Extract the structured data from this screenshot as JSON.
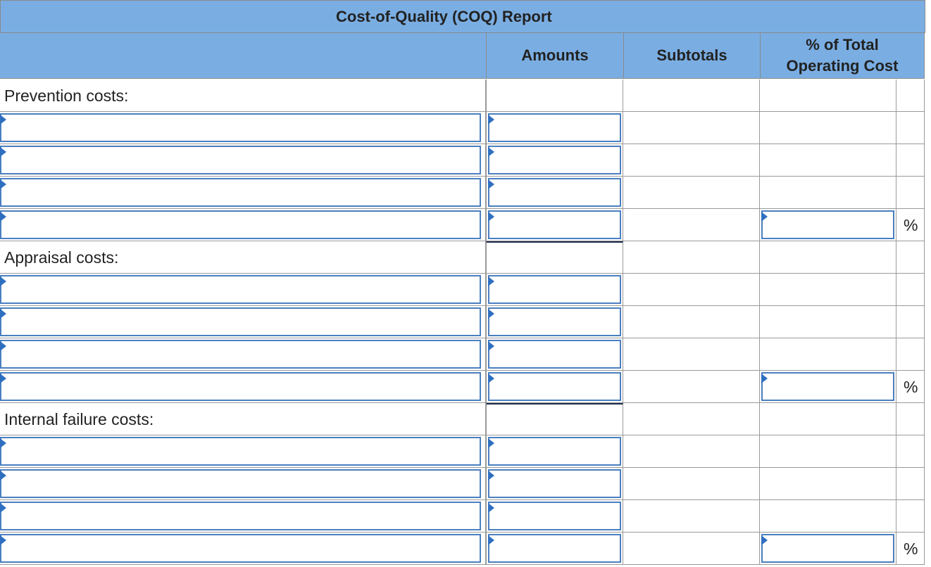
{
  "report": {
    "title": "Cost-of-Quality (COQ) Report",
    "headers": {
      "amounts": "Amounts",
      "subtotals": "Subtotals",
      "pct_line1": "% of Total",
      "pct_line2": "Operating Cost"
    },
    "sections": [
      {
        "label": "Prevention costs:",
        "pct_symbol": "%"
      },
      {
        "label": "Appraisal costs:",
        "pct_symbol": "%"
      },
      {
        "label": "Internal failure costs:",
        "pct_symbol": "%"
      }
    ]
  },
  "colors": {
    "header_bg": "#7aaee3",
    "input_border": "#4a7fc0",
    "marker": "#2f6fc0"
  }
}
